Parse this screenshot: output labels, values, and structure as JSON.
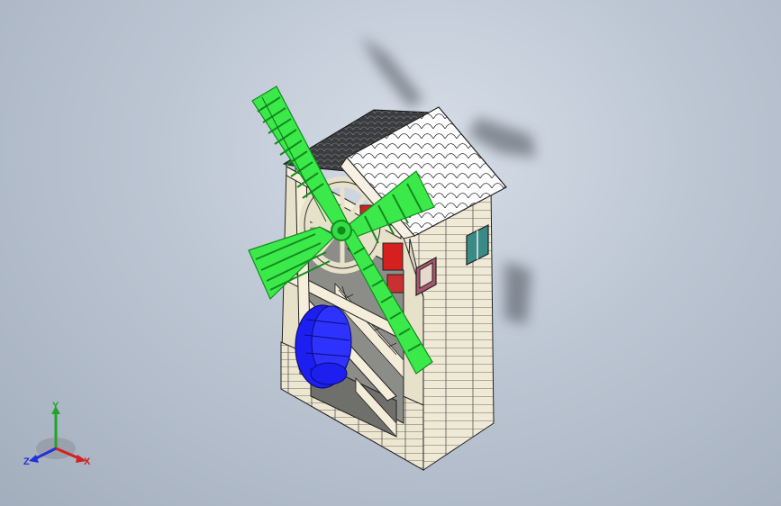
{
  "colors": {
    "background_top": "#d6dde7",
    "background_bottom": "#a3aebd",
    "sail_green": "#33dd44",
    "sail_outline": "#138a1f",
    "wall_cream": "#efe9d6",
    "roof_white": "#ffffff",
    "roof_dark": "#2f3033",
    "water_wheel_blue": "#1d1ff0",
    "gear_red": "#d62020",
    "window_teal": "#3a8a86",
    "axis_x": "#d42020",
    "axis_y": "#1fa52a",
    "axis_z": "#2430d8"
  },
  "model": {
    "name": "windmill",
    "parts": [
      "sails",
      "roof",
      "tower",
      "water-wheel",
      "staircase",
      "gear",
      "windows"
    ]
  },
  "triad": {
    "x_label": "X",
    "y_label": "Y",
    "z_label": "Z"
  }
}
